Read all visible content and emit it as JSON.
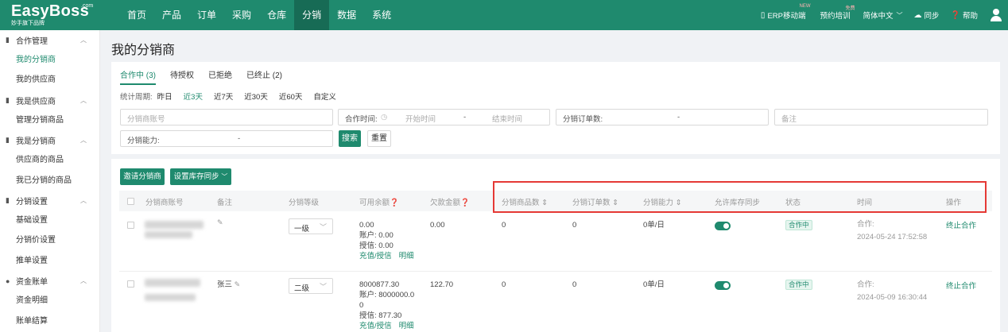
{
  "logo": {
    "name": "EasyBoss",
    "com": ".com",
    "tagline": "妙手旗下品牌"
  },
  "nav": [
    "首页",
    "产品",
    "订单",
    "采购",
    "仓库",
    "分销",
    "数据",
    "系统"
  ],
  "nav_active": "分销",
  "top_right": {
    "erp_mobile": "ERP移动端",
    "erp_badge": "NEW",
    "training": "预约培训",
    "training_badge": "免费",
    "language": "简体中文",
    "sync": "同步",
    "help": "帮助"
  },
  "sidebar": [
    {
      "group": "合作管理",
      "items": [
        "我的分销商",
        "我的供应商"
      ]
    },
    {
      "group": "我是供应商",
      "items": [
        "管理分销商品"
      ]
    },
    {
      "group": "我是分销商",
      "items": [
        "供应商的商品",
        "我已分销的商品"
      ]
    },
    {
      "group": "分销设置",
      "items": [
        "基础设置",
        "分销价设置",
        "推单设置"
      ]
    },
    {
      "group": "资金账单",
      "items": [
        "资金明细",
        "账单结算"
      ]
    }
  ],
  "sidebar_active": "我的分销商",
  "page_title": "我的分销商",
  "tabs": [
    "合作中 (3)",
    "待授权",
    "已拒绝",
    "已终止 (2)"
  ],
  "range": {
    "label": "统计周期:",
    "options": [
      "昨日",
      "近3天",
      "近7天",
      "近30天",
      "近60天",
      "自定义"
    ],
    "active": "近3天"
  },
  "filters": {
    "account_placeholder": "分销商账号",
    "coop_time_label": "合作时间:",
    "start_placeholder": "开始时间",
    "end_placeholder": "结束时间",
    "range_sep": "-",
    "orders_label": "分销订单数:",
    "remark_placeholder": "备注",
    "ability_label": "分销能力:",
    "search": "搜索",
    "reset": "重置"
  },
  "actions": {
    "invite": "邀请分销商",
    "stock_sync": "设置库存同步"
  },
  "columns": [
    "分销商账号",
    "备注",
    "分销等级",
    "可用余额",
    "欠款金额",
    "分销商品数",
    "分销订单数",
    "分销能力",
    "允许库存同步",
    "状态",
    "时间",
    "操作"
  ],
  "rows": [
    {
      "remark": "",
      "level": "一级",
      "balance": "0.00",
      "account_balance": "账户: 0.00",
      "credit": "授信: 0.00",
      "recharge": "充值/授信",
      "detail": "明细",
      "debt": "0.00",
      "products": "0",
      "orders": "0",
      "ability": "0单/日",
      "status": "合作中",
      "time_label": "合作:",
      "time": "2024-05-24 17:52:58",
      "op": "终止合作"
    },
    {
      "remark": "张三",
      "level": "二级",
      "balance": "8000877.30",
      "account_balance": "账户: 8000000.0",
      "account_balance_wrap": "0",
      "credit": "授信: 877.30",
      "recharge": "充值/授信",
      "detail": "明细",
      "debt": "122.70",
      "products": "0",
      "orders": "0",
      "ability": "0单/日",
      "status": "合作中",
      "time_label": "合作:",
      "time": "2024-05-09 16:30:44",
      "op": "终止合作"
    }
  ],
  "colors": {
    "brand": "#1f8a6e",
    "highlight": "#e53935"
  }
}
